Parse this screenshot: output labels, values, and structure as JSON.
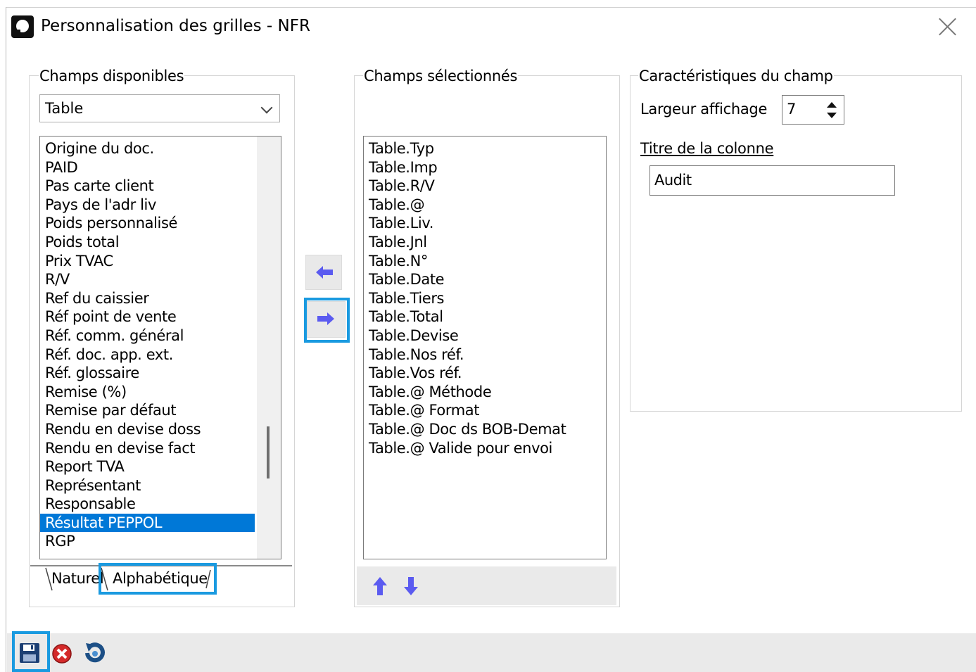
{
  "window": {
    "title": "Personnalisation des grilles - NFR"
  },
  "available": {
    "legend": "Champs disponibles",
    "dropdown_value": "Table",
    "items": [
      "Origine du doc.",
      "PAID",
      "Pas carte client",
      "Pays de l'adr liv",
      "Poids personnalisé",
      "Poids total",
      "Prix TVAC",
      "R/V",
      "Ref du caissier",
      "Réf point de vente",
      "Réf. comm. général",
      "Réf. doc. app. ext.",
      "Réf. glossaire",
      "Remise (%)",
      "Remise par défaut",
      "Rendu en devise doss",
      "Rendu en devise fact",
      "Report TVA",
      "Représentant",
      "Responsable",
      "Résultat PEPPOL",
      "RGP"
    ],
    "selected_index": 20,
    "tabs": [
      "Naturel",
      "Alphabétique"
    ],
    "active_tab": "Alphabétique"
  },
  "selected": {
    "legend": "Champs sélectionnés",
    "items": [
      "Table.Typ",
      "Table.Imp",
      "Table.R/V",
      "Table.@",
      "Table.Liv.",
      "Table.Jnl",
      "Table.N°",
      "Table.Date",
      "Table.Tiers",
      "Table.Total",
      "Table.Devise",
      "Table.Nos réf.",
      "Table.Vos réf.",
      "Table.@ Méthode",
      "Table.@ Format",
      "Table.@ Doc ds BOB-Demat",
      "Table.@ Valide pour envoi"
    ]
  },
  "properties": {
    "legend": "Caractéristiques du champ",
    "width_label": "Largeur  affichage",
    "width_value": "7",
    "column_title_label": "Titre de la colonne",
    "column_title_value": "Audit"
  },
  "icons": {
    "move_left": "arrow-left-icon",
    "move_right": "arrow-right-icon",
    "move_up": "arrow-up-icon",
    "move_down": "arrow-down-icon",
    "save": "save-icon",
    "cancel": "cancel-icon",
    "reset": "reset-icon"
  },
  "colors": {
    "highlight": "#1a9ae0",
    "selection": "#0078d7",
    "arrow": "#5b5bf0"
  }
}
